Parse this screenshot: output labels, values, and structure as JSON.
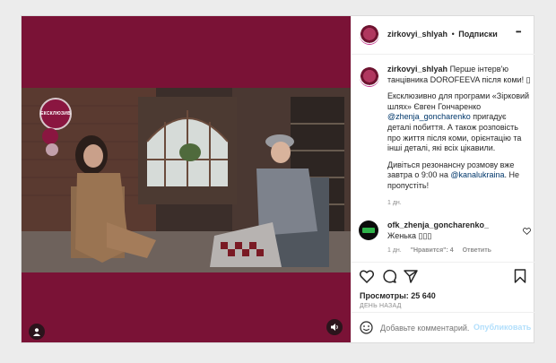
{
  "post": {
    "username": "zirkovyi_shlyah",
    "separator": "•",
    "follow_label": "Подписки",
    "more_label": "•••"
  },
  "video": {
    "logo_text": "ЕКСКЛЮЗИВ",
    "background_color": "#7a1236"
  },
  "caption": {
    "username": "zirkovyi_shlyah",
    "line1": "Перше інтерв'ю танцівника DOROFEEVA після коми! ▯",
    "line2_pre": "Ексклюзивно для програми «Зірковий шлях» Євген Гончаренко ",
    "mention1": "@zhenja_goncharenko",
    "line2_post": " пригадує деталі побиття. А також розповість про життя після коми, орієнтацію та інші деталі, які всіх цікавили.",
    "line3_pre": "Дивіться резонансну розмову вже завтра о 9:00 на ",
    "mention2": "@kanalukraina",
    "line3_post": ". Не пропустіть!",
    "time": "1 дн."
  },
  "comment": {
    "username": "ofk_zhenja_goncharenko_",
    "text": "Женька ▯▯▯",
    "time": "1 дн.",
    "likes": "\"Нравится\": 4",
    "reply": "Ответить"
  },
  "stats": {
    "views": "Просмотры: 25 640",
    "posted": "день назад"
  },
  "add_comment": {
    "placeholder": "Добавьте комментарий...",
    "publish_label": "Опубликовать"
  },
  "colors": {
    "brand_maroon": "#7a1236",
    "link": "#00376b",
    "publish_disabled": "#b2dffc"
  }
}
